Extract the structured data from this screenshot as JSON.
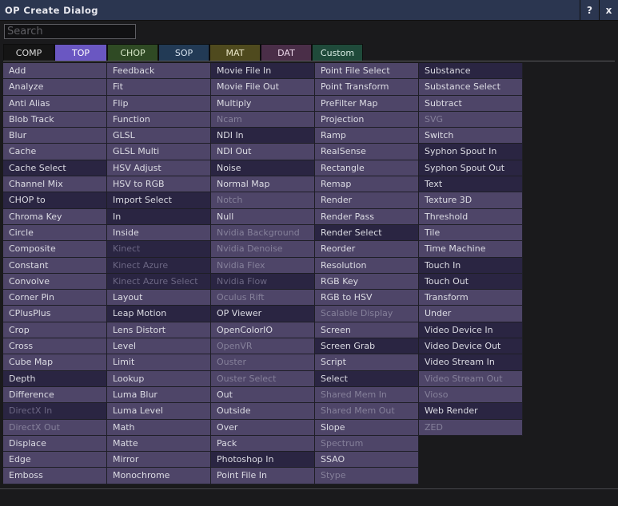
{
  "window": {
    "title": "OP Create Dialog",
    "help_label": "?",
    "close_label": "x"
  },
  "search": {
    "placeholder": "Search"
  },
  "tabs": [
    {
      "label": "COMP",
      "bg": "#151515",
      "fg": "#dcdcdc"
    },
    {
      "label": "TOP",
      "bg": "#6a57c2",
      "fg": "#ffffff"
    },
    {
      "label": "CHOP",
      "bg": "#2f4a24",
      "fg": "#d8e8c8"
    },
    {
      "label": "SOP",
      "bg": "#223a55",
      "fg": "#d8e4f0"
    },
    {
      "label": "MAT",
      "bg": "#4f4a1e",
      "fg": "#ece8c8"
    },
    {
      "label": "DAT",
      "bg": "#4a2e48",
      "fg": "#ecd8ea"
    },
    {
      "label": "Custom",
      "bg": "#1f4a3a",
      "fg": "#d8ece4"
    }
  ],
  "columns": [
    [
      {
        "label": "Add",
        "s": "light"
      },
      {
        "label": "Analyze",
        "s": "light"
      },
      {
        "label": "Anti Alias",
        "s": "light"
      },
      {
        "label": "Blob Track",
        "s": "light"
      },
      {
        "label": "Blur",
        "s": "light"
      },
      {
        "label": "Cache",
        "s": "light"
      },
      {
        "label": "Cache Select",
        "s": "dark"
      },
      {
        "label": "Channel Mix",
        "s": "light"
      },
      {
        "label": "CHOP to",
        "s": "dark"
      },
      {
        "label": "Chroma Key",
        "s": "light"
      },
      {
        "label": "Circle",
        "s": "light"
      },
      {
        "label": "Composite",
        "s": "light"
      },
      {
        "label": "Constant",
        "s": "light"
      },
      {
        "label": "Convolve",
        "s": "light"
      },
      {
        "label": "Corner Pin",
        "s": "light"
      },
      {
        "label": "CPlusPlus",
        "s": "light"
      },
      {
        "label": "Crop",
        "s": "light"
      },
      {
        "label": "Cross",
        "s": "light"
      },
      {
        "label": "Cube Map",
        "s": "light"
      },
      {
        "label": "Depth",
        "s": "dark"
      },
      {
        "label": "Difference",
        "s": "light"
      },
      {
        "label": "DirectX In",
        "s": "dis-dark"
      },
      {
        "label": "DirectX Out",
        "s": "dis"
      },
      {
        "label": "Displace",
        "s": "light"
      },
      {
        "label": "Edge",
        "s": "light"
      },
      {
        "label": "Emboss",
        "s": "light"
      }
    ],
    [
      {
        "label": "Feedback",
        "s": "light"
      },
      {
        "label": "Fit",
        "s": "light"
      },
      {
        "label": "Flip",
        "s": "light"
      },
      {
        "label": "Function",
        "s": "light"
      },
      {
        "label": "GLSL",
        "s": "light"
      },
      {
        "label": "GLSL Multi",
        "s": "light"
      },
      {
        "label": "HSV Adjust",
        "s": "light"
      },
      {
        "label": "HSV to RGB",
        "s": "light"
      },
      {
        "label": "Import Select",
        "s": "dark"
      },
      {
        "label": "In",
        "s": "dark"
      },
      {
        "label": "Inside",
        "s": "light"
      },
      {
        "label": "Kinect",
        "s": "dis-dark"
      },
      {
        "label": "Kinect Azure",
        "s": "dis-dark"
      },
      {
        "label": "Kinect Azure Select",
        "s": "dis-dark"
      },
      {
        "label": "Layout",
        "s": "light"
      },
      {
        "label": "Leap Motion",
        "s": "dark"
      },
      {
        "label": "Lens Distort",
        "s": "light"
      },
      {
        "label": "Level",
        "s": "light"
      },
      {
        "label": "Limit",
        "s": "light"
      },
      {
        "label": "Lookup",
        "s": "light"
      },
      {
        "label": "Luma Blur",
        "s": "light"
      },
      {
        "label": "Luma Level",
        "s": "light"
      },
      {
        "label": "Math",
        "s": "light"
      },
      {
        "label": "Matte",
        "s": "light"
      },
      {
        "label": "Mirror",
        "s": "light"
      },
      {
        "label": "Monochrome",
        "s": "light"
      }
    ],
    [
      {
        "label": "Movie File In",
        "s": "dark"
      },
      {
        "label": "Movie File Out",
        "s": "light"
      },
      {
        "label": "Multiply",
        "s": "light"
      },
      {
        "label": "Ncam",
        "s": "dis"
      },
      {
        "label": "NDI In",
        "s": "dark"
      },
      {
        "label": "NDI Out",
        "s": "light"
      },
      {
        "label": "Noise",
        "s": "dark"
      },
      {
        "label": "Normal Map",
        "s": "light"
      },
      {
        "label": "Notch",
        "s": "dis"
      },
      {
        "label": "Null",
        "s": "light"
      },
      {
        "label": "Nvidia Background",
        "s": "dis"
      },
      {
        "label": "Nvidia Denoise",
        "s": "dis"
      },
      {
        "label": "Nvidia Flex",
        "s": "dis"
      },
      {
        "label": "Nvidia Flow",
        "s": "dis-dark"
      },
      {
        "label": "Oculus Rift",
        "s": "dis"
      },
      {
        "label": "OP Viewer",
        "s": "dark"
      },
      {
        "label": "OpenColorIO",
        "s": "light"
      },
      {
        "label": "OpenVR",
        "s": "dis"
      },
      {
        "label": "Ouster",
        "s": "dis"
      },
      {
        "label": "Ouster Select",
        "s": "dis"
      },
      {
        "label": "Out",
        "s": "light"
      },
      {
        "label": "Outside",
        "s": "light"
      },
      {
        "label": "Over",
        "s": "light"
      },
      {
        "label": "Pack",
        "s": "light"
      },
      {
        "label": "Photoshop In",
        "s": "dark"
      },
      {
        "label": "Point File In",
        "s": "light"
      }
    ],
    [
      {
        "label": "Point File Select",
        "s": "light"
      },
      {
        "label": "Point Transform",
        "s": "light"
      },
      {
        "label": "PreFilter Map",
        "s": "light"
      },
      {
        "label": "Projection",
        "s": "light"
      },
      {
        "label": "Ramp",
        "s": "light"
      },
      {
        "label": "RealSense",
        "s": "light"
      },
      {
        "label": "Rectangle",
        "s": "light"
      },
      {
        "label": "Remap",
        "s": "light"
      },
      {
        "label": "Render",
        "s": "light"
      },
      {
        "label": "Render Pass",
        "s": "light"
      },
      {
        "label": "Render Select",
        "s": "dark"
      },
      {
        "label": "Reorder",
        "s": "light"
      },
      {
        "label": "Resolution",
        "s": "light"
      },
      {
        "label": "RGB Key",
        "s": "light"
      },
      {
        "label": "RGB to HSV",
        "s": "light"
      },
      {
        "label": "Scalable Display",
        "s": "dis"
      },
      {
        "label": "Screen",
        "s": "light"
      },
      {
        "label": "Screen Grab",
        "s": "dark"
      },
      {
        "label": "Script",
        "s": "light"
      },
      {
        "label": "Select",
        "s": "dark"
      },
      {
        "label": "Shared Mem In",
        "s": "dis"
      },
      {
        "label": "Shared Mem Out",
        "s": "dis"
      },
      {
        "label": "Slope",
        "s": "light"
      },
      {
        "label": "Spectrum",
        "s": "dis"
      },
      {
        "label": "SSAO",
        "s": "light"
      },
      {
        "label": "Stype",
        "s": "dis"
      }
    ],
    [
      {
        "label": "Substance",
        "s": "dark"
      },
      {
        "label": "Substance Select",
        "s": "light"
      },
      {
        "label": "Subtract",
        "s": "light"
      },
      {
        "label": "SVG",
        "s": "dis"
      },
      {
        "label": "Switch",
        "s": "light"
      },
      {
        "label": "Syphon Spout In",
        "s": "dark"
      },
      {
        "label": "Syphon Spout Out",
        "s": "dark"
      },
      {
        "label": "Text",
        "s": "dark"
      },
      {
        "label": "Texture 3D",
        "s": "light"
      },
      {
        "label": "Threshold",
        "s": "light"
      },
      {
        "label": "Tile",
        "s": "light"
      },
      {
        "label": "Time Machine",
        "s": "light"
      },
      {
        "label": "Touch In",
        "s": "dark"
      },
      {
        "label": "Touch Out",
        "s": "dark"
      },
      {
        "label": "Transform",
        "s": "light"
      },
      {
        "label": "Under",
        "s": "light"
      },
      {
        "label": "Video Device In",
        "s": "dark"
      },
      {
        "label": "Video Device Out",
        "s": "dark"
      },
      {
        "label": "Video Stream In",
        "s": "dark"
      },
      {
        "label": "Video Stream Out",
        "s": "dis"
      },
      {
        "label": "Vioso",
        "s": "dis"
      },
      {
        "label": "Web Render",
        "s": "dark"
      },
      {
        "label": "ZED",
        "s": "dis"
      }
    ]
  ]
}
